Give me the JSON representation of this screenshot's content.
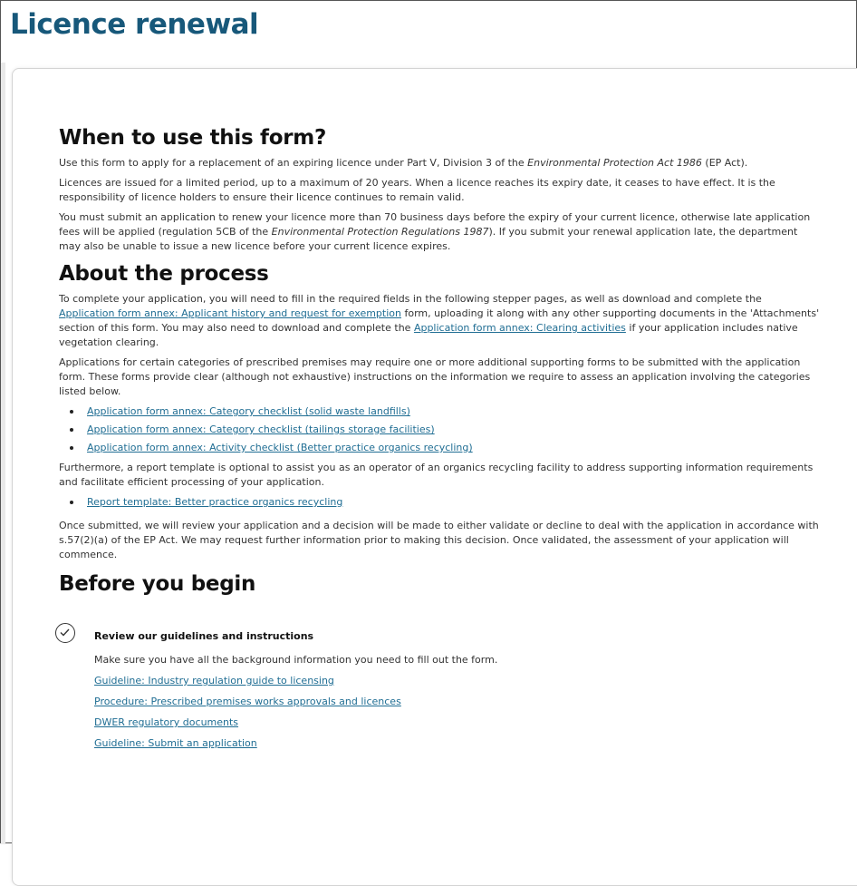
{
  "page": {
    "title": "Licence renewal"
  },
  "when": {
    "heading": "When to use this form?",
    "p1_pre": "Use this form to apply for a replacement of an expiring licence under Part V, Division 3 of the ",
    "p1_em": "Environmental Protection Act 1986",
    "p1_post": " (EP Act).",
    "p2": "Licences are issued for a limited period, up to a maximum of 20 years. When a licence reaches its expiry date, it ceases to have effect. It is the responsibility of licence holders to ensure their licence continues to remain valid.",
    "p3_pre": "You must submit an application to renew your licence more than 70 business days before the expiry of your current licence, otherwise late application fees will be applied (regulation 5CB of the ",
    "p3_em": "Environmental Protection Regulations 1987",
    "p3_post": "). If you submit your renewal application late, the department may also be unable to issue a new licence before your current licence expires."
  },
  "about": {
    "heading": "About the process",
    "p1_a": "To complete your application, you will need to fill in the required fields in the following stepper pages, as well as download and complete the ",
    "p1_link1": "Application form annex: Applicant history and request for exemption",
    "p1_b": " form, uploading it along with any other supporting documents in the 'Attachments' section of this form. You may also need to download and complete the ",
    "p1_link2": "Application form annex: Clearing activities",
    "p1_c": " if your application includes native vegetation clearing.",
    "p2": "Applications for certain categories of prescribed premises may require one or more additional supporting forms to be submitted with the application form. These forms provide clear (although not exhaustive) instructions on the information we require to assess an application involving the categories listed below.",
    "category_links": [
      "Application form annex: Category checklist (solid waste landfills)",
      "Application form annex: Category checklist (tailings storage facilities)",
      "Application form annex: Activity checklist (Better practice organics recycling)"
    ],
    "p3": "Furthermore, a report template is optional to assist you as an operator of an organics recycling facility to address supporting information requirements and facilitate efficient processing of your application.",
    "report_links": [
      "Report template: Better practice organics recycling"
    ],
    "p4": "Once submitted, we will review your application and a decision will be made to either validate or decline to deal with the application in accordance with s.57(2)(a) of the EP Act. We may request further information prior to making this decision. Once validated, the assessment of your application will commence."
  },
  "begin": {
    "heading": "Before you begin",
    "step1": {
      "title": "Review our guidelines and instructions",
      "text": "Make sure you have all the background information you need to fill out the form.",
      "links": [
        "Guideline: Industry regulation guide to licensing",
        "Procedure: Prescribed premises works approvals and licences",
        "DWER regulatory documents",
        "Guideline: Submit an application"
      ]
    }
  },
  "colors": {
    "title": "#17587a",
    "link": "#1f6d93",
    "text": "#333333"
  },
  "icons": {
    "step_status": "check-circle-icon"
  }
}
